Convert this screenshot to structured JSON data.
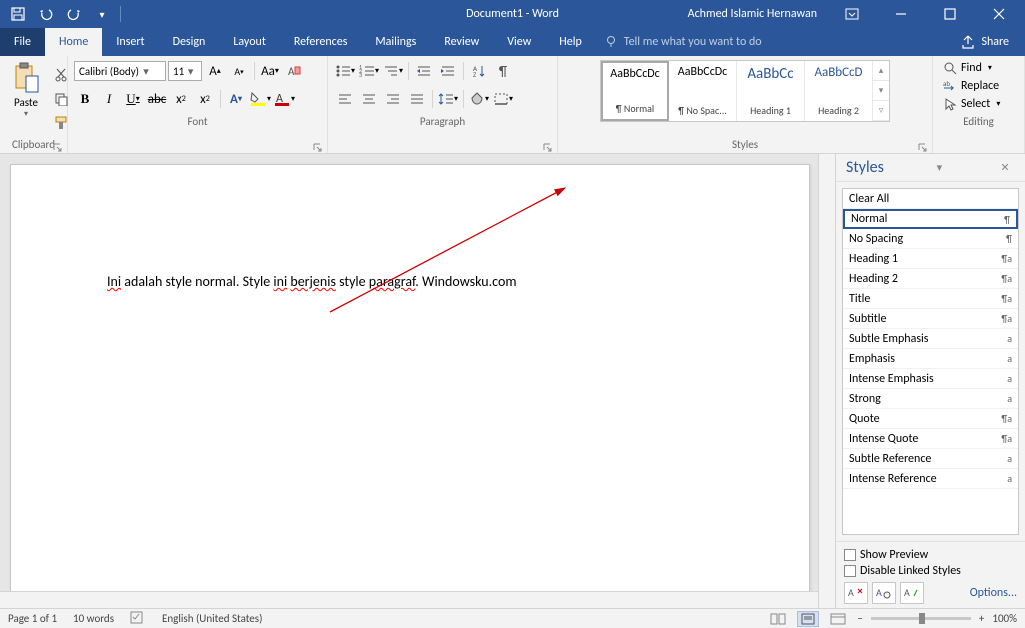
{
  "title": "Document1 - Word",
  "user": "Achmed Islamic Hernawan",
  "tabs": [
    "File",
    "Home",
    "Insert",
    "Design",
    "Layout",
    "References",
    "Mailings",
    "Review",
    "View",
    "Help"
  ],
  "tell_me": "Tell me what you want to do",
  "share": "Share",
  "groups": {
    "clipboard": "Clipboard",
    "font": "Font",
    "paragraph": "Paragraph",
    "styles": "Styles",
    "editing": "Editing"
  },
  "paste": "Paste",
  "font_name": "Calibri (Body)",
  "font_size": "11",
  "style_items": [
    {
      "preview": "AaBbCcDc",
      "name": "¶ Normal"
    },
    {
      "preview": "AaBbCcDc",
      "name": "¶ No Spac..."
    },
    {
      "preview": "AaBbCc",
      "name": "Heading 1"
    },
    {
      "preview": "AaBbCcD",
      "name": "Heading 2"
    }
  ],
  "editing": {
    "find": "Find",
    "replace": "Replace",
    "select": "Select"
  },
  "doc_text_parts": [
    "Ini",
    " adalah style normal. Style ",
    "ini",
    " ",
    "berjenis",
    " style ",
    "paragraf",
    ". Windowsku.com"
  ],
  "styles_pane": {
    "title": "Styles",
    "items": [
      {
        "name": "Clear All",
        "sym": ""
      },
      {
        "name": "Normal",
        "sym": "¶"
      },
      {
        "name": "No Spacing",
        "sym": "¶"
      },
      {
        "name": "Heading 1",
        "sym": "¶a"
      },
      {
        "name": "Heading 2",
        "sym": "¶a"
      },
      {
        "name": "Title",
        "sym": "¶a"
      },
      {
        "name": "Subtitle",
        "sym": "¶a"
      },
      {
        "name": "Subtle Emphasis",
        "sym": "a"
      },
      {
        "name": "Emphasis",
        "sym": "a"
      },
      {
        "name": "Intense Emphasis",
        "sym": "a"
      },
      {
        "name": "Strong",
        "sym": "a"
      },
      {
        "name": "Quote",
        "sym": "¶a"
      },
      {
        "name": "Intense Quote",
        "sym": "¶a"
      },
      {
        "name": "Subtle Reference",
        "sym": "a"
      },
      {
        "name": "Intense Reference",
        "sym": "a"
      }
    ],
    "show_preview": "Show Preview",
    "disable_linked": "Disable Linked Styles",
    "options": "Options..."
  },
  "status": {
    "page": "Page 1 of 1",
    "words": "10 words",
    "lang": "English (United States)",
    "zoom": "100%"
  }
}
